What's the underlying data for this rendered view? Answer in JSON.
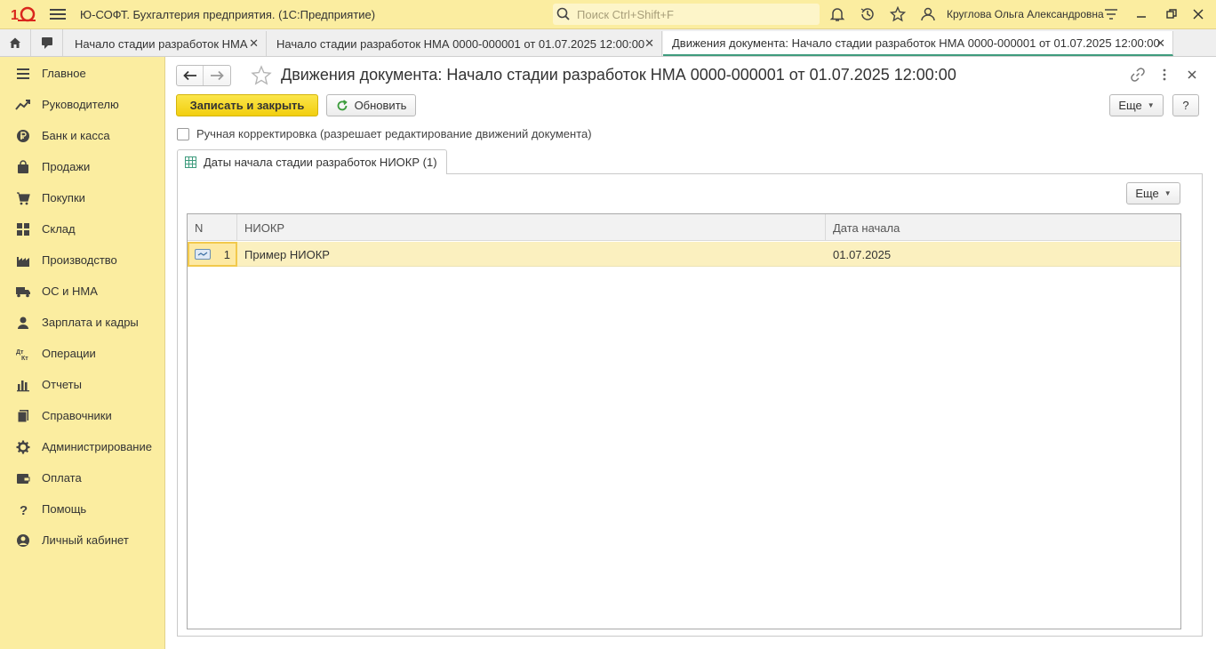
{
  "titlebar": {
    "app_title": "Ю-СОФТ. Бухгалтерия предприятия.  (1С:Предприятие)",
    "search_placeholder": "Поиск Ctrl+Shift+F",
    "user_name": "Круглова Ольга Александровна"
  },
  "tabs": [
    {
      "label": "Начало стадии разработок НМА",
      "active": false
    },
    {
      "label": "Начало стадии разработок НМА 0000-000001 от 01.07.2025 12:00:00",
      "active": false
    },
    {
      "label": "Движения документа: Начало стадии разработок НМА 0000-000001 от 01.07.2025 12:00:00",
      "active": true
    }
  ],
  "sidebar": {
    "items": [
      {
        "label": "Главное",
        "icon": "menu-lines-icon"
      },
      {
        "label": "Руководителю",
        "icon": "trend-icon"
      },
      {
        "label": "Банк и касса",
        "icon": "ruble-coin-icon"
      },
      {
        "label": "Продажи",
        "icon": "shopping-bag-icon"
      },
      {
        "label": "Покупки",
        "icon": "cart-icon"
      },
      {
        "label": "Склад",
        "icon": "warehouse-icon"
      },
      {
        "label": "Производство",
        "icon": "factory-icon"
      },
      {
        "label": "ОС и НМА",
        "icon": "truck-icon"
      },
      {
        "label": "Зарплата и кадры",
        "icon": "person-icon"
      },
      {
        "label": "Операции",
        "icon": "dt-kt-icon"
      },
      {
        "label": "Отчеты",
        "icon": "bar-chart-icon"
      },
      {
        "label": "Справочники",
        "icon": "books-icon"
      },
      {
        "label": "Администрирование",
        "icon": "gear-icon"
      },
      {
        "label": "Оплата",
        "icon": "wallet-icon"
      },
      {
        "label": "Помощь",
        "icon": "question-icon"
      },
      {
        "label": "Личный кабинет",
        "icon": "account-icon"
      }
    ]
  },
  "document": {
    "title": "Движения документа: Начало стадии разработок НМА 0000-000001 от 01.07.2025 12:00:00",
    "save_close_label": "Записать и закрыть",
    "refresh_label": "Обновить",
    "more_label": "Еще",
    "help_label": "?",
    "manual_edit_label": "Ручная корректировка (разрешает редактирование движений документа)",
    "manual_edit_checked": false
  },
  "panel": {
    "tab_label": "Даты начала стадии разработок НИОКР (1)",
    "more_label": "Еще",
    "columns": [
      "N",
      "НИОКР",
      "Дата начала"
    ],
    "rows": [
      {
        "n": "1",
        "niokr": "Пример НИОКР",
        "date": "01.07.2025"
      }
    ]
  },
  "colors": {
    "accent_yellow": "#fbeda0",
    "primary_button": "#f5d417",
    "active_tab_underline": "#3e9b7d",
    "selected_row": "#fbf0bf",
    "logo_red": "#d9261c"
  }
}
